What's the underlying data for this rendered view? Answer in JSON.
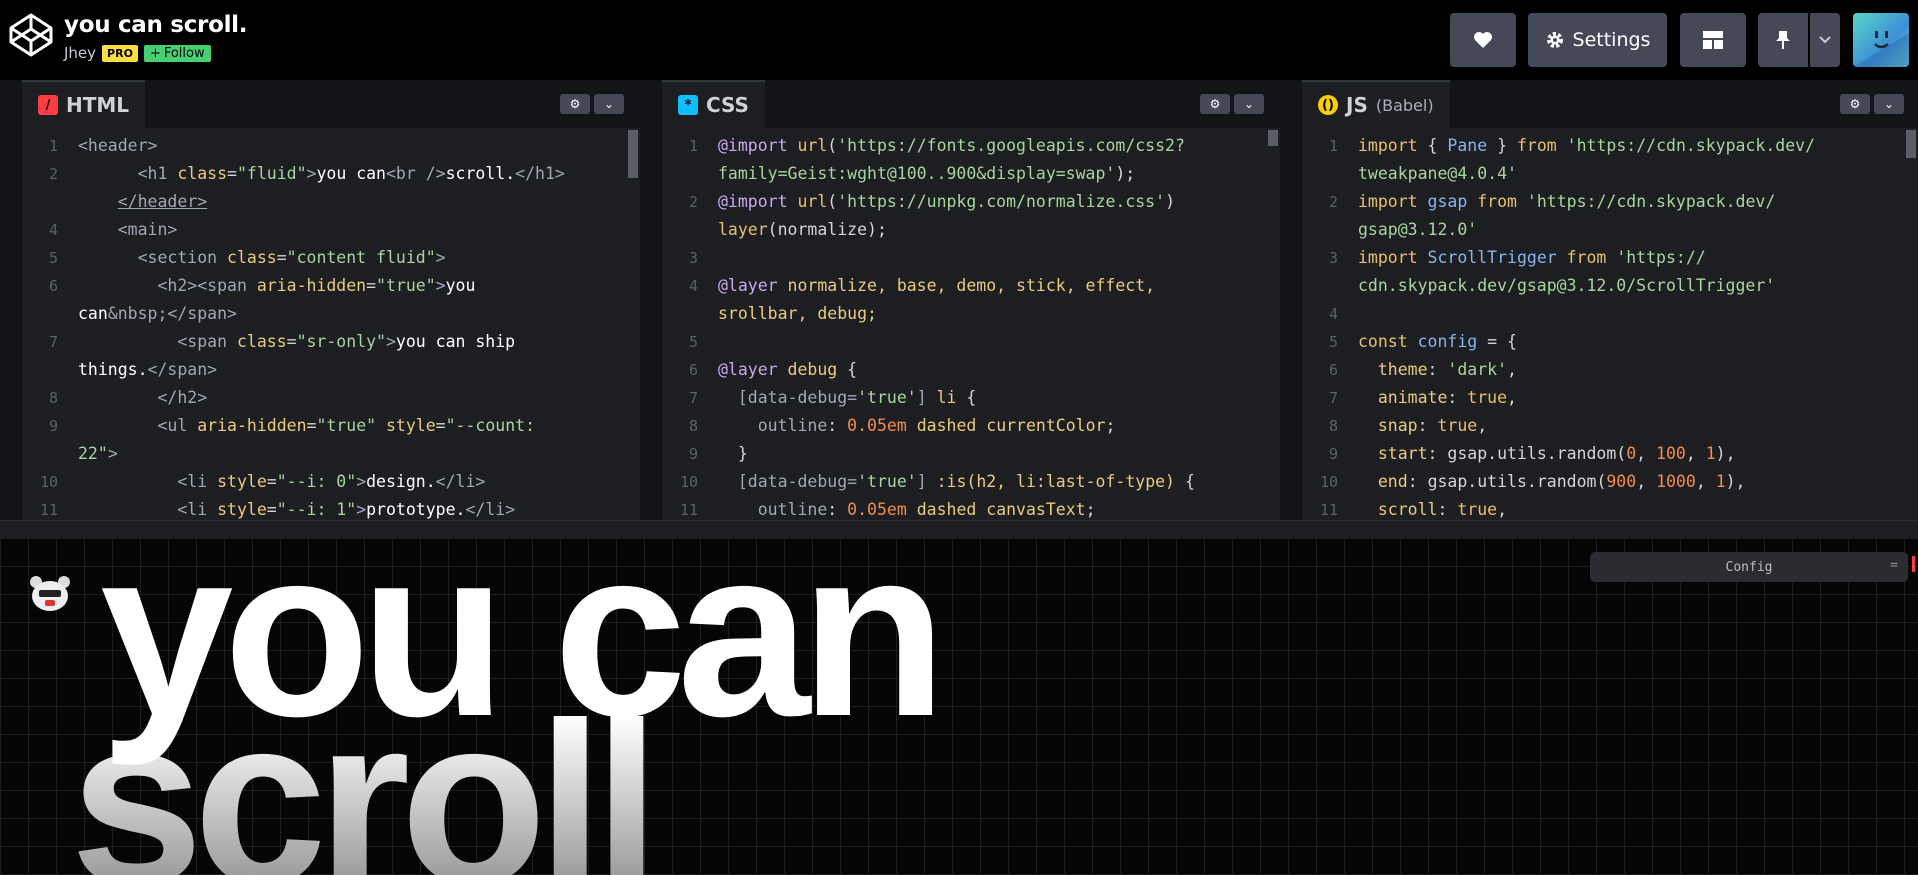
{
  "header": {
    "title": "you can scroll.",
    "author": "Jhey",
    "pro_badge": "PRO",
    "follow_label": "Follow",
    "settings_label": "Settings"
  },
  "editors": {
    "html": {
      "label": "HTML",
      "lines": [
        {
          "n": "1",
          "html": "<span class='t'>&lt;header&gt;</span>"
        },
        {
          "n": "2",
          "html": "      <span class='t'>&lt;h1</span> <span class='a'>class</span><span class='p'>=</span><span class='s'>\"fluid\"</span><span class='t'>&gt;</span>you can<span class='t'>&lt;br /&gt;</span>scroll.<span class='t'>&lt;/h1&gt;</span>"
        },
        {
          "n": "",
          "html": "    <span class='t' style='text-decoration:underline;'>&lt;/header&gt;</span>"
        },
        {
          "n": "4",
          "html": "    <span class='t'>&lt;main&gt;</span>"
        },
        {
          "n": "5",
          "html": "      <span class='t'>&lt;section</span> <span class='a'>class</span><span class='p'>=</span><span class='s'>\"content fluid\"</span><span class='t'>&gt;</span>"
        },
        {
          "n": "6",
          "html": "        <span class='t'>&lt;h2&gt;&lt;span</span> <span class='a'>aria-hidden</span><span class='p'>=</span><span class='s'>\"true\"</span><span class='t'>&gt;</span>you"
        },
        {
          "n": "",
          "html": "can<span class='t'>&amp;nbsp;&lt;/span&gt;</span>"
        },
        {
          "n": "7",
          "html": "          <span class='t'>&lt;span</span> <span class='a'>class</span><span class='p'>=</span><span class='s'>\"sr-only\"</span><span class='t'>&gt;</span>you can ship"
        },
        {
          "n": "",
          "html": "things.<span class='t'>&lt;/span&gt;</span>"
        },
        {
          "n": "8",
          "html": "        <span class='t'>&lt;/h2&gt;</span>"
        },
        {
          "n": "9",
          "html": "        <span class='t'>&lt;ul</span> <span class='a'>aria-hidden</span><span class='p'>=</span><span class='s'>\"true\"</span> <span class='a'>style</span><span class='p'>=</span><span class='s'>\"--count:</span>"
        },
        {
          "n": "",
          "html": "<span class='s'>22\"</span><span class='t'>&gt;</span>"
        },
        {
          "n": "10",
          "html": "          <span class='t'>&lt;li</span> <span class='a'>style</span><span class='p'>=</span><span class='s'>\"--i: 0\"</span><span class='t'>&gt;</span>design.<span class='t'>&lt;/li&gt;</span>"
        },
        {
          "n": "11",
          "html": "          <span class='t'>&lt;li</span> <span class='a'>style</span><span class='p'>=</span><span class='s'>\"--i: 1\"</span><span class='t'>&gt;</span>prototype.<span class='t'>&lt;/li&gt;</span>"
        }
      ]
    },
    "css": {
      "label": "CSS",
      "lines": [
        {
          "n": "1",
          "html": "<span class='k'>@import</span> <span class='kw'>url</span><span class='p'>(</span><span class='s'>'https://fonts.googleapis.com/css2?</span>"
        },
        {
          "n": "",
          "html": "<span class='s'>family=Geist:wght@100..900&amp;display=swap'</span><span class='p'>);</span>"
        },
        {
          "n": "2",
          "html": "<span class='k'>@import</span> <span class='kw'>url</span><span class='p'>(</span><span class='s'>'https://unpkg.com/normalize.css'</span><span class='p'>)</span>"
        },
        {
          "n": "",
          "html": "<span class='kw'>layer</span><span class='p'>(normalize);</span>"
        },
        {
          "n": "3",
          "html": ""
        },
        {
          "n": "4",
          "html": "<span class='k'>@layer</span> <span class='a'>normalize, base, demo, stick, effect,</span>"
        },
        {
          "n": "",
          "html": "<span class='a'>srollbar, debug;</span>"
        },
        {
          "n": "5",
          "html": ""
        },
        {
          "n": "6",
          "html": "<span class='k'>@layer</span> <span class='a'>debug</span> <span class='p'>{</span>"
        },
        {
          "n": "7",
          "html": "  <span class='t'>[data-debug=</span><span class='s'>'true'</span><span class='t'>]</span> <span class='a'>li</span> <span class='p'>{</span>"
        },
        {
          "n": "8",
          "html": "    <span class='t'>outline</span><span class='p'>:</span> <span class='n'>0.05em</span> <span class='a'>dashed currentColor</span><span class='p'>;</span>"
        },
        {
          "n": "9",
          "html": "  <span class='p'>}</span>"
        },
        {
          "n": "10",
          "html": "  <span class='t'>[data-debug=</span><span class='s'>'true'</span><span class='t'>]</span> <span class='a'>:is(h2, li:last-of-type)</span> <span class='p'>{</span>"
        },
        {
          "n": "11",
          "html": "    <span class='t'>outline</span><span class='p'>:</span> <span class='n'>0.05em</span> <span class='a'>dashed canvasText</span><span class='p'>;</span>"
        }
      ]
    },
    "js": {
      "label": "JS",
      "sublabel": "(Babel)",
      "lines": [
        {
          "n": "1",
          "html": "<span class='kw'>import</span> <span class='p'>{</span> <span class='v'>Pane</span> <span class='p'>}</span> <span class='kw'>from</span> <span class='s'>'https://cdn.skypack.dev/</span>"
        },
        {
          "n": "",
          "html": "<span class='s'>tweakpane@4.0.4'</span>"
        },
        {
          "n": "2",
          "html": "<span class='kw'>import</span> <span class='v'>gsap</span> <span class='kw'>from</span> <span class='s'>'https://cdn.skypack.dev/</span>"
        },
        {
          "n": "",
          "html": "<span class='s'>gsap@3.12.0'</span>"
        },
        {
          "n": "3",
          "html": "<span class='kw'>import</span> <span class='v'>ScrollTrigger</span> <span class='kw'>from</span> <span class='s'>'https://</span>"
        },
        {
          "n": "",
          "html": "<span class='s'>cdn.skypack.dev/gsap@3.12.0/ScrollTrigger'</span>"
        },
        {
          "n": "4",
          "html": ""
        },
        {
          "n": "5",
          "html": "<span class='kw'>const</span> <span class='v'>config</span> <span class='p'>= {</span>"
        },
        {
          "n": "6",
          "html": "  <span class='a'>theme</span><span class='p'>:</span> <span class='s'>'dark'</span><span class='p'>,</span>"
        },
        {
          "n": "7",
          "html": "  <span class='a'>animate</span><span class='p'>:</span> <span class='kw'>true</span><span class='p'>,</span>"
        },
        {
          "n": "8",
          "html": "  <span class='a'>snap</span><span class='p'>:</span> <span class='kw'>true</span><span class='p'>,</span>"
        },
        {
          "n": "9",
          "html": "  <span class='a'>start</span><span class='p'>:</span> <span class='p'>gsap.utils.random(</span><span class='n'>0</span><span class='p'>,</span> <span class='n'>100</span><span class='p'>,</span> <span class='n'>1</span><span class='p'>),</span>"
        },
        {
          "n": "10",
          "html": "  <span class='a'>end</span><span class='p'>:</span> <span class='p'>gsap.utils.random(</span><span class='n'>900</span><span class='p'>,</span> <span class='n'>1000</span><span class='p'>,</span> <span class='n'>1</span><span class='p'>),</span>"
        },
        {
          "n": "11",
          "html": "  <span class='a'>scroll</span><span class='p'>:</span> <span class='kw'>true</span><span class='p'>,</span>"
        }
      ]
    }
  },
  "preview": {
    "line1": "you can",
    "line2": "scroll",
    "config_label": "Config",
    "config_menu": "="
  },
  "colors": {
    "html_icon": "#ff3c41",
    "css_icon": "#0ebeff",
    "js_icon": "#fcd000",
    "pro": "#ffdd40",
    "follow": "#47cf73"
  }
}
